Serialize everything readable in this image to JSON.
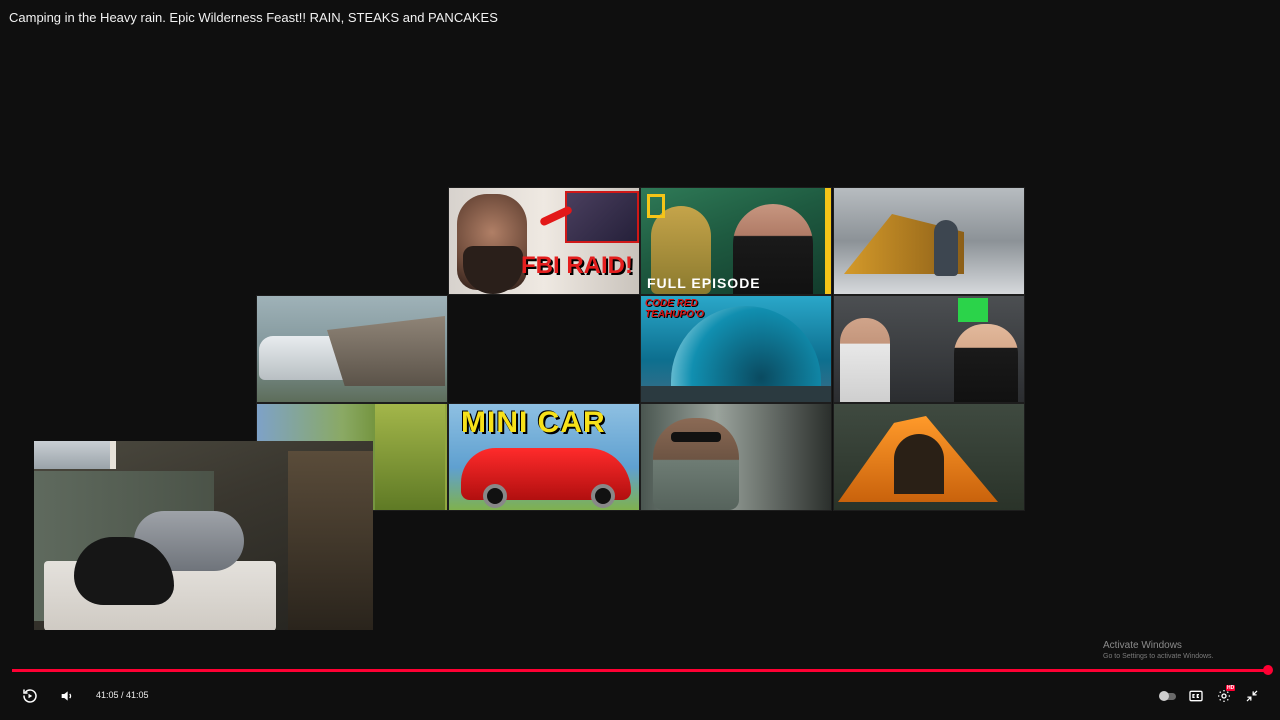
{
  "video": {
    "title": "Camping in the Heavy rain. Epic Wilderness Feast!! RAIN, STEAKS and PANCAKES"
  },
  "endscreen": {
    "thumbnails": [
      {
        "id": "fbi-raid",
        "text": "FBI RAID!"
      },
      {
        "id": "snake",
        "text": "FULL EPISODE"
      },
      {
        "id": "snow-camp",
        "text": ""
      },
      {
        "id": "rain-camp",
        "text": ""
      },
      {
        "id": "wave",
        "text": "CODE RED TEAHUPO'O"
      },
      {
        "id": "gym",
        "text": ""
      },
      {
        "id": "forest",
        "text": ""
      },
      {
        "id": "mini-car",
        "text": "MINI CAR"
      },
      {
        "id": "driving",
        "text": ""
      },
      {
        "id": "orange-tent",
        "text": ""
      }
    ]
  },
  "player": {
    "progress_fraction": 1.0,
    "time_display": "41:05 / 41:05",
    "accent_color": "#ff0033",
    "controls": {
      "replay_icon": "replay-icon",
      "volume_icon": "volume-icon",
      "autoplay_icon": "autoplay-toggle-icon",
      "captions_icon": "captions-icon",
      "settings_icon": "gear-icon",
      "settings_badge": "HD",
      "exit_fullscreen_icon": "exit-fullscreen-icon"
    }
  },
  "watermark": {
    "title": "Activate Windows",
    "subtitle": "Go to Settings to activate Windows."
  }
}
